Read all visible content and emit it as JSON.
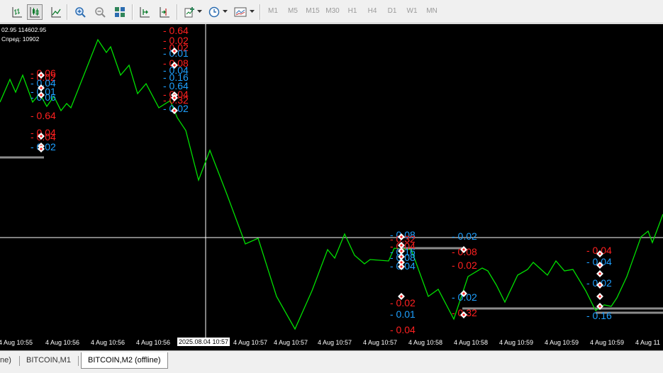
{
  "toolbar": {
    "buttons": [
      {
        "name": "bar-chart-icon"
      },
      {
        "name": "candlestick-chart-icon"
      },
      {
        "name": "line-chart-icon"
      },
      {
        "name": "zoom-in-icon"
      },
      {
        "name": "zoom-out-icon"
      },
      {
        "name": "tile-windows-icon"
      },
      {
        "name": "auto-scroll-icon"
      },
      {
        "name": "chart-shift-icon"
      },
      {
        "name": "add-indicator-icon"
      },
      {
        "name": "periods-clock-icon"
      },
      {
        "name": "templates-icon"
      }
    ],
    "timeframes": [
      "M1",
      "M5",
      "M15",
      "M30",
      "H1",
      "H4",
      "D1",
      "W1",
      "MN"
    ]
  },
  "chart": {
    "info_prices": "02.95 114602.95",
    "info_spread": "Спред: 10902",
    "crosshair_time": "2025.08.04 10:57",
    "x_labels": [
      "4 Aug 10:55",
      "4 Aug 10:56",
      "4 Aug 10:56",
      "4 Aug 10:56",
      "4 Aug 10:57",
      "4 Aug 10:57",
      "4 Aug 10:57",
      "4 Aug 10:57",
      "4 Aug 10:58",
      "4 Aug 10:58",
      "4 Aug 10:59",
      "4 Aug 10:59",
      "4 Aug 10:59",
      "4 Aug 11"
    ],
    "line_color": "#00e000",
    "sell_color": "#ff2020",
    "buy_color": "#1ea0ff",
    "annotations": [
      {
        "t": "- 0.06",
        "c": "sell"
      },
      {
        "t": "- 0.02",
        "c": "sell"
      },
      {
        "t": "- 0.04",
        "c": "buy"
      },
      {
        "t": "- 0.01",
        "c": "buy"
      },
      {
        "t": "- 0.06",
        "c": "buy"
      },
      {
        "t": "- 0.64",
        "c": "sell"
      },
      {
        "t": "- 0.04",
        "c": "sell"
      },
      {
        "t": "- 0.04",
        "c": "sell"
      },
      {
        "t": "- 0.02",
        "c": "buy"
      },
      {
        "t": "- 0.64",
        "c": "sell"
      },
      {
        "t": "- 0.02",
        "c": "sell"
      },
      {
        "t": "- 0.02",
        "c": "sell"
      },
      {
        "t": "- 0.01",
        "c": "buy"
      },
      {
        "t": "- 0.08",
        "c": "sell"
      },
      {
        "t": "- 0.04",
        "c": "buy"
      },
      {
        "t": "- 0.16",
        "c": "buy"
      },
      {
        "t": "- 0.64",
        "c": "buy"
      },
      {
        "t": "- 0.04",
        "c": "sell"
      },
      {
        "t": "- 0.32",
        "c": "sell"
      },
      {
        "t": "- 0.02",
        "c": "buy"
      },
      {
        "t": "- 0.08",
        "c": "buy"
      },
      {
        "t": "- 0.32",
        "c": "sell"
      },
      {
        "t": "- 0.04",
        "c": "sell"
      },
      {
        "t": "- 0.16",
        "c": "buy"
      },
      {
        "t": "- 0.08",
        "c": "buy"
      },
      {
        "t": "- 0.04",
        "c": "buy"
      },
      {
        "t": "- 0.02",
        "c": "sell"
      },
      {
        "t": "- 0.01",
        "c": "buy"
      },
      {
        "t": "- 0.04",
        "c": "sell"
      },
      {
        "t": "- 0.02",
        "c": "buy"
      },
      {
        "t": "- 0.08",
        "c": "sell"
      },
      {
        "t": "- 0.02",
        "c": "sell"
      },
      {
        "t": "- 0.02",
        "c": "buy"
      },
      {
        "t": "- 0.32",
        "c": "sell"
      },
      {
        "t": "- 0.04",
        "c": "sell"
      },
      {
        "t": "- 0.04",
        "c": "buy"
      },
      {
        "t": "- 0.02",
        "c": "buy"
      },
      {
        "t": "- 0.16",
        "c": "buy"
      }
    ]
  },
  "tabs": {
    "items": [
      "ne)",
      "BITCOIN,M1",
      "BITCOIN,M2 (offline)"
    ],
    "active": 2
  }
}
